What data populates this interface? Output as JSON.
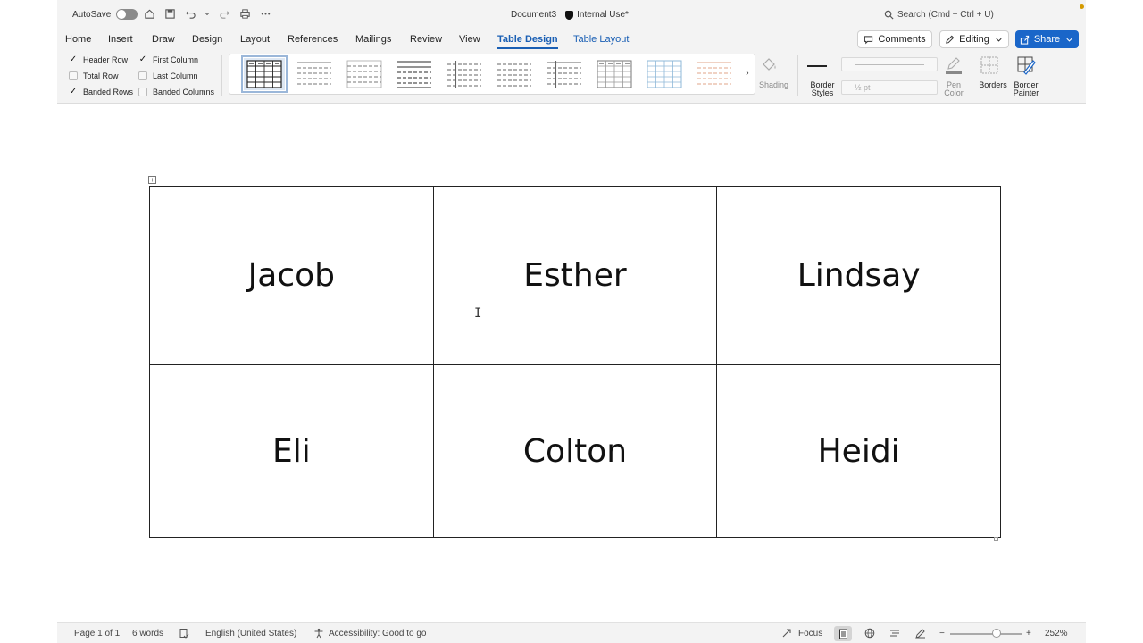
{
  "titlebar": {
    "autosave_label": "AutoSave",
    "document_title": "Document3",
    "sensitivity_label": "Internal Use*",
    "search_placeholder": "Search (Cmd + Ctrl + U)"
  },
  "tabs": [
    {
      "label": "Home"
    },
    {
      "label": "Insert"
    },
    {
      "label": "Draw"
    },
    {
      "label": "Design"
    },
    {
      "label": "Layout"
    },
    {
      "label": "References"
    },
    {
      "label": "Mailings"
    },
    {
      "label": "Review"
    },
    {
      "label": "View"
    },
    {
      "label": "Table Design"
    },
    {
      "label": "Table Layout"
    }
  ],
  "actions": {
    "comments_label": "Comments",
    "editing_label": "Editing",
    "share_label": "Share"
  },
  "style_options": {
    "header_row": "Header Row",
    "first_column": "First Column",
    "total_row": "Total Row",
    "last_column": "Last Column",
    "banded_rows": "Banded Rows",
    "banded_columns": "Banded Columns",
    "check": "✓"
  },
  "ribbon": {
    "shading_label": "Shading",
    "border_styles_label_1": "Border",
    "border_styles_label_2": "Styles",
    "pen_weight": "½ pt",
    "pen_color_label_1": "Pen",
    "pen_color_label_2": "Color",
    "borders_label": "Borders",
    "border_painter_label_1": "Border",
    "border_painter_label_2": "Painter",
    "more_arrow": "›"
  },
  "table": {
    "rows": [
      [
        "Jacob",
        "Esther",
        "Lindsay"
      ],
      [
        "Eli",
        "Colton",
        "Heidi"
      ]
    ]
  },
  "statusbar": {
    "page": "Page 1 of 1",
    "words": "6 words",
    "language": "English (United States)",
    "accessibility": "Accessibility: Good to go",
    "focus": "Focus",
    "zoom": "252%",
    "zoom_minus": "−",
    "zoom_plus": "+"
  },
  "colors": {
    "accent": "#1a5fb4",
    "share_bg": "#1a66c9"
  }
}
